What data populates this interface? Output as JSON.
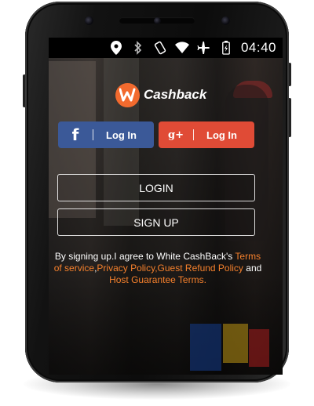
{
  "status_bar": {
    "icons": [
      "location-icon",
      "bluetooth-icon",
      "vibrate-icon",
      "wifi-icon",
      "airplane-icon",
      "battery-icon"
    ],
    "time": "04:40"
  },
  "brand": {
    "logo_icon": "w-logo-icon",
    "name": "Cashback",
    "accent_color": "#f26a2e"
  },
  "social_login": {
    "facebook": {
      "icon": "f",
      "label": "Log In",
      "color": "#3b5998"
    },
    "google_plus": {
      "icon": "g+",
      "label": "Log In",
      "color": "#e04b36"
    }
  },
  "auth": {
    "login_label": "LOGIN",
    "signup_label": "SIGN UP"
  },
  "terms": {
    "prefix": "By signing up.I agree to White CashBack's ",
    "terms_link": "Terms of service",
    "sep1": ",",
    "privacy_link": "Privacy Policy",
    "sep2": ",",
    "refund_link": "Guest Refund Policy",
    "and": " and ",
    "host_link": "Host Guarantee Terms",
    "suffix": ".",
    "link_color": "#f5802c"
  }
}
